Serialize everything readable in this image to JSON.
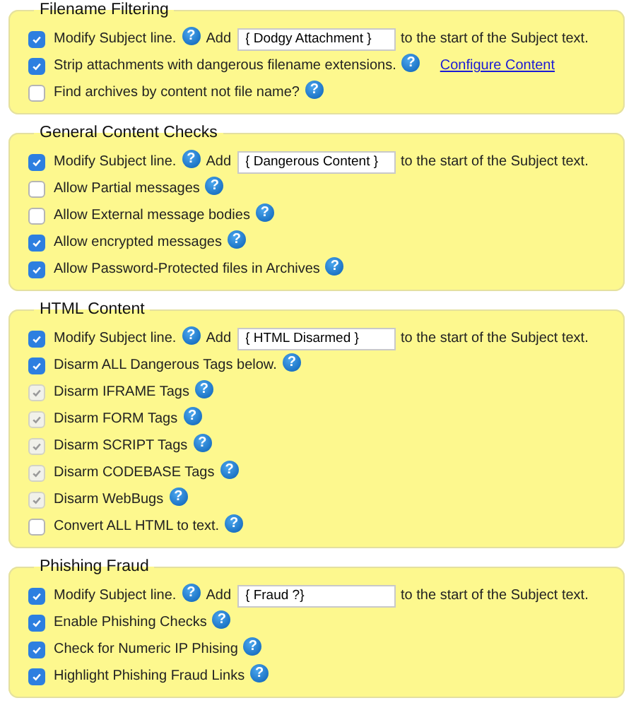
{
  "sections": [
    {
      "title": "Filename Filtering",
      "items": [
        {
          "kind": "subject",
          "label": "Modify Subject line.",
          "checked": true,
          "disabled": false,
          "help": "?",
          "add": "Add",
          "value": "{ Dodgy Attachment }",
          "suffix": "to the start of the Subject text."
        },
        {
          "kind": "check",
          "label": "Strip attachments with dangerous filename extensions.",
          "checked": true,
          "disabled": false,
          "help": "?",
          "link": "Configure Content"
        },
        {
          "kind": "check",
          "label": "Find archives by content not file name?",
          "checked": false,
          "disabled": false,
          "help": "?"
        }
      ]
    },
    {
      "title": "General Content Checks",
      "items": [
        {
          "kind": "subject",
          "label": "Modify Subject line.",
          "checked": true,
          "disabled": false,
          "help": "?",
          "add": "Add",
          "value": "{ Dangerous Content }",
          "suffix": "to the start of the Subject text."
        },
        {
          "kind": "check",
          "label": "Allow Partial messages",
          "checked": false,
          "disabled": false,
          "help": "?"
        },
        {
          "kind": "check",
          "label": "Allow External message bodies",
          "checked": false,
          "disabled": false,
          "help": "?"
        },
        {
          "kind": "check",
          "label": "Allow encrypted messages",
          "checked": true,
          "disabled": false,
          "help": "?"
        },
        {
          "kind": "check",
          "label": "Allow Password-Protected files in Archives",
          "checked": true,
          "disabled": false,
          "help": "?"
        }
      ]
    },
    {
      "title": "HTML Content",
      "items": [
        {
          "kind": "subject",
          "label": "Modify Subject line.",
          "checked": true,
          "disabled": false,
          "help": "?",
          "add": "Add",
          "value": "{ HTML Disarmed }",
          "suffix": "to the start of the Subject text."
        },
        {
          "kind": "check",
          "label": "Disarm ALL Dangerous Tags below.",
          "checked": true,
          "disabled": false,
          "help": "?"
        },
        {
          "kind": "check",
          "label": "Disarm IFRAME Tags",
          "checked": true,
          "disabled": true,
          "help": "?"
        },
        {
          "kind": "check",
          "label": "Disarm FORM Tags",
          "checked": true,
          "disabled": true,
          "help": "?"
        },
        {
          "kind": "check",
          "label": "Disarm SCRIPT Tags",
          "checked": true,
          "disabled": true,
          "help": "?"
        },
        {
          "kind": "check",
          "label": "Disarm CODEBASE Tags",
          "checked": true,
          "disabled": true,
          "help": "?"
        },
        {
          "kind": "check",
          "label": "Disarm WebBugs",
          "checked": true,
          "disabled": true,
          "help": "?"
        },
        {
          "kind": "check",
          "label": "Convert ALL HTML to text.",
          "checked": false,
          "disabled": false,
          "help": "?"
        }
      ]
    },
    {
      "title": "Phishing Fraud",
      "items": [
        {
          "kind": "subject",
          "label": "Modify Subject line.",
          "checked": true,
          "disabled": false,
          "help": "?",
          "add": "Add",
          "value": "{ Fraud ?}",
          "suffix": "to the start of the Subject text."
        },
        {
          "kind": "check",
          "label": "Enable Phishing Checks",
          "checked": true,
          "disabled": false,
          "help": "?"
        },
        {
          "kind": "check",
          "label": "Check for Numeric IP Phising",
          "checked": true,
          "disabled": false,
          "help": "?"
        },
        {
          "kind": "check",
          "label": "Highlight Phishing Fraud Links",
          "checked": true,
          "disabled": false,
          "help": "?"
        }
      ]
    }
  ]
}
